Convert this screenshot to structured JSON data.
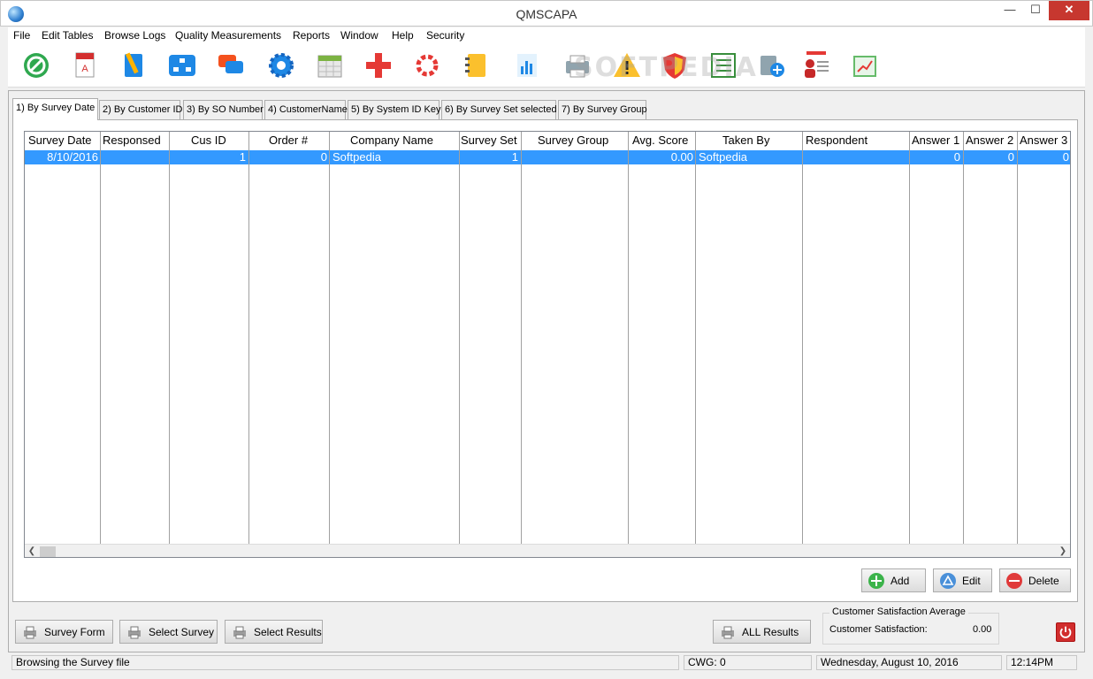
{
  "window": {
    "title": "QMSCAPA",
    "minimize": "—",
    "maximize": "☐",
    "close": "✕"
  },
  "menu": [
    "File",
    "Edit Tables",
    "Browse Logs",
    "Quality Measurements",
    "Reports",
    "Window",
    "Help",
    "Security"
  ],
  "toolbar": {
    "icons": [
      "no-entry-icon",
      "pdf-document-icon",
      "notebook-pencil-icon",
      "org-chart-icon",
      "chat-bubbles-icon",
      "gear-icon",
      "calendar-icon",
      "red-cross-icon",
      "lifebuoy-icon",
      "address-book-icon",
      "bar-chart-icon",
      "printer-icon",
      "warning-icon",
      "shield-icon",
      "checklist-icon",
      "database-add-icon",
      "user-card-icon",
      "clipboard-chart-icon"
    ],
    "watermark": "SOFTPEDIA"
  },
  "tabs": [
    "1) By Survey Date",
    "2) By Customer ID",
    "3) By SO Number",
    "4) CustomerName",
    "5) By System ID Key",
    "6) By Survey Set selected",
    "7) By Survey Group"
  ],
  "grid": {
    "columns": [
      "Survey Date",
      "Responsed",
      "Cus ID",
      "Order #",
      "Company Name",
      "Survey Set",
      "Survey Group",
      "Avg. Score",
      "Taken By",
      "Respondent",
      "Answer 1",
      "Answer 2",
      "Answer 3"
    ],
    "rows": [
      [
        "8/10/2016",
        "",
        "1",
        "0",
        "Softpedia",
        "1",
        "",
        "0.00",
        "Softpedia",
        "",
        "0",
        "0",
        "0"
      ]
    ]
  },
  "actions": {
    "add": "Add",
    "edit": "Edit",
    "delete": "Delete"
  },
  "bottom": {
    "survey_form": "Survey Form",
    "select_survey": "Select Survey",
    "select_results": "Select Results",
    "all_results": "ALL Results"
  },
  "satisfaction": {
    "group_title": "Customer Satisfaction Average",
    "label": "Customer Satisfaction:",
    "value": "0.00"
  },
  "status": {
    "message": "Browsing the Survey file",
    "cwg": "CWG: 0",
    "date": "Wednesday, August 10, 2016",
    "time": "12:14PM"
  },
  "colors": {
    "selection": "#3399ff",
    "close_button": "#c7372f",
    "power_button": "#d12d2d"
  }
}
